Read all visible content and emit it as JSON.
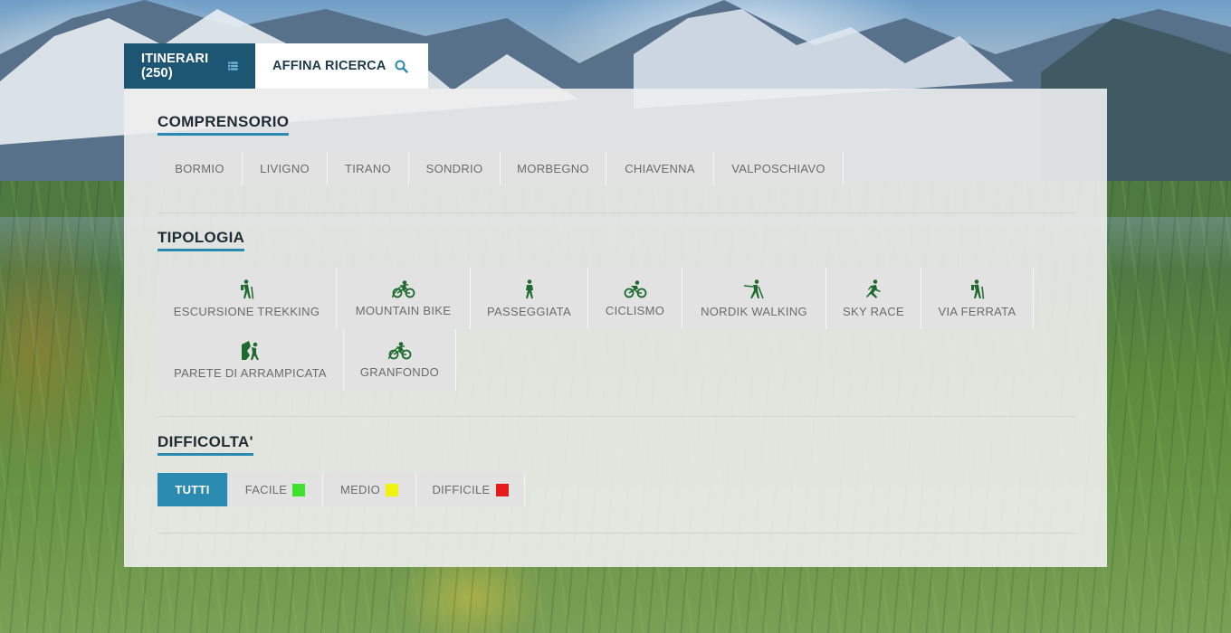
{
  "tabs": {
    "itinerari": {
      "label": "ITINERARI (250)",
      "icon": "list-icon"
    },
    "affina": {
      "label": "AFFINA RICERCA",
      "icon": "search-icon"
    }
  },
  "comprensorio": {
    "title": "COMPRENSORIO",
    "items": [
      "BORMIO",
      "LIVIGNO",
      "TIRANO",
      "SONDRIO",
      "MORBEGNO",
      "CHIAVENNA",
      "VALPOSCHIAVO"
    ]
  },
  "tipologia": {
    "title": "TIPOLOGIA",
    "items": [
      {
        "label": "ESCURSIONE TREKKING",
        "icon": "hiker-icon"
      },
      {
        "label": "MOUNTAIN BIKE",
        "icon": "mountain-bike-icon"
      },
      {
        "label": "PASSEGGIATA",
        "icon": "walker-icon"
      },
      {
        "label": "CICLISMO",
        "icon": "cyclist-icon"
      },
      {
        "label": "NORDIK WALKING",
        "icon": "nordic-walking-icon"
      },
      {
        "label": "SKY RACE",
        "icon": "runner-icon"
      },
      {
        "label": "VIA FERRATA",
        "icon": "hiker-icon"
      },
      {
        "label": "PARETE DI ARRAMPICATA",
        "icon": "climbing-icon"
      },
      {
        "label": "GRANFONDO",
        "icon": "mountain-bike-icon"
      }
    ],
    "icon_color": "#1e6b2f"
  },
  "difficolta": {
    "title": "DIFFICOLTA'",
    "items": [
      {
        "label": "TUTTI",
        "active": true
      },
      {
        "label": "FACILE",
        "color": "#3fe12a"
      },
      {
        "label": "MEDIO",
        "color": "#f2f210"
      },
      {
        "label": "DIFFICILE",
        "color": "#e51b1b"
      }
    ]
  },
  "colors": {
    "tab_active": "#1d5673",
    "accent": "#2a8ab0"
  }
}
